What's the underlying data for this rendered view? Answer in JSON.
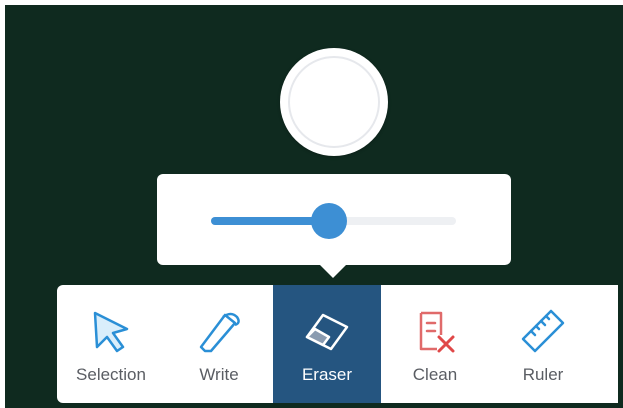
{
  "board": {
    "background_color": "#0f2a1f"
  },
  "eraser_size_slider": {
    "value_fraction": 0.48,
    "accent_color": "#3d8fd4"
  },
  "toolbar": {
    "active_tool": "Eraser",
    "active_color": "#255580",
    "tools": [
      {
        "label": "Selection",
        "icon": "cursor-arrow-icon"
      },
      {
        "label": "Write",
        "icon": "pencil-icon"
      },
      {
        "label": "Eraser",
        "icon": "eraser-icon"
      },
      {
        "label": "Clean",
        "icon": "clear-document-icon"
      },
      {
        "label": "Ruler",
        "icon": "ruler-icon"
      }
    ]
  }
}
